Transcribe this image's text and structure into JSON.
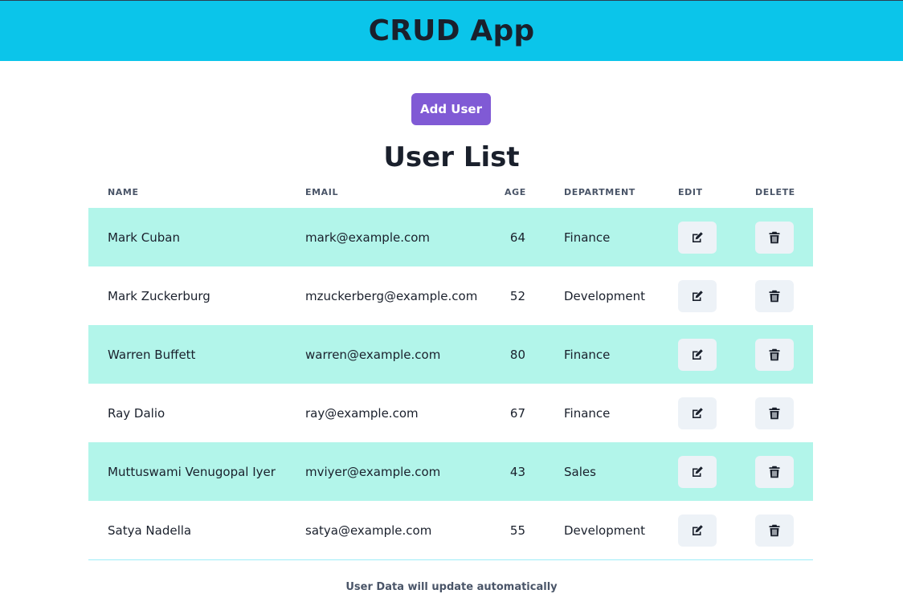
{
  "header": {
    "title": "CRUD App"
  },
  "actions": {
    "add_user_label": "Add User"
  },
  "list": {
    "title": "User List",
    "columns": {
      "name": "NAME",
      "email": "EMAIL",
      "age": "AGE",
      "department": "DEPARTMENT",
      "edit": "EDIT",
      "delete": "DELETE"
    },
    "rows": [
      {
        "name": "Mark Cuban",
        "email": "mark@example.com",
        "age": "64",
        "department": "Finance"
      },
      {
        "name": "Mark Zuckerburg",
        "email": "mzuckerberg@example.com",
        "age": "52",
        "department": "Development"
      },
      {
        "name": "Warren Buffett",
        "email": "warren@example.com",
        "age": "80",
        "department": "Finance"
      },
      {
        "name": "Ray Dalio",
        "email": "ray@example.com",
        "age": "67",
        "department": "Finance"
      },
      {
        "name": "Muttuswami Venugopal Iyer",
        "email": "mviyer@example.com",
        "age": "43",
        "department": "Sales"
      },
      {
        "name": "Satya Nadella",
        "email": "satya@example.com",
        "age": "55",
        "department": "Development"
      }
    ],
    "row_icons": {
      "edit": "edit-icon",
      "delete": "trash-icon"
    }
  },
  "footer": {
    "note": "User Data will update automatically"
  },
  "colors": {
    "header_bg": "#0bc5ea",
    "add_button": "#805ad5",
    "row_stripe": "#b2f5ea",
    "icon_button_bg": "#edf2f7"
  }
}
